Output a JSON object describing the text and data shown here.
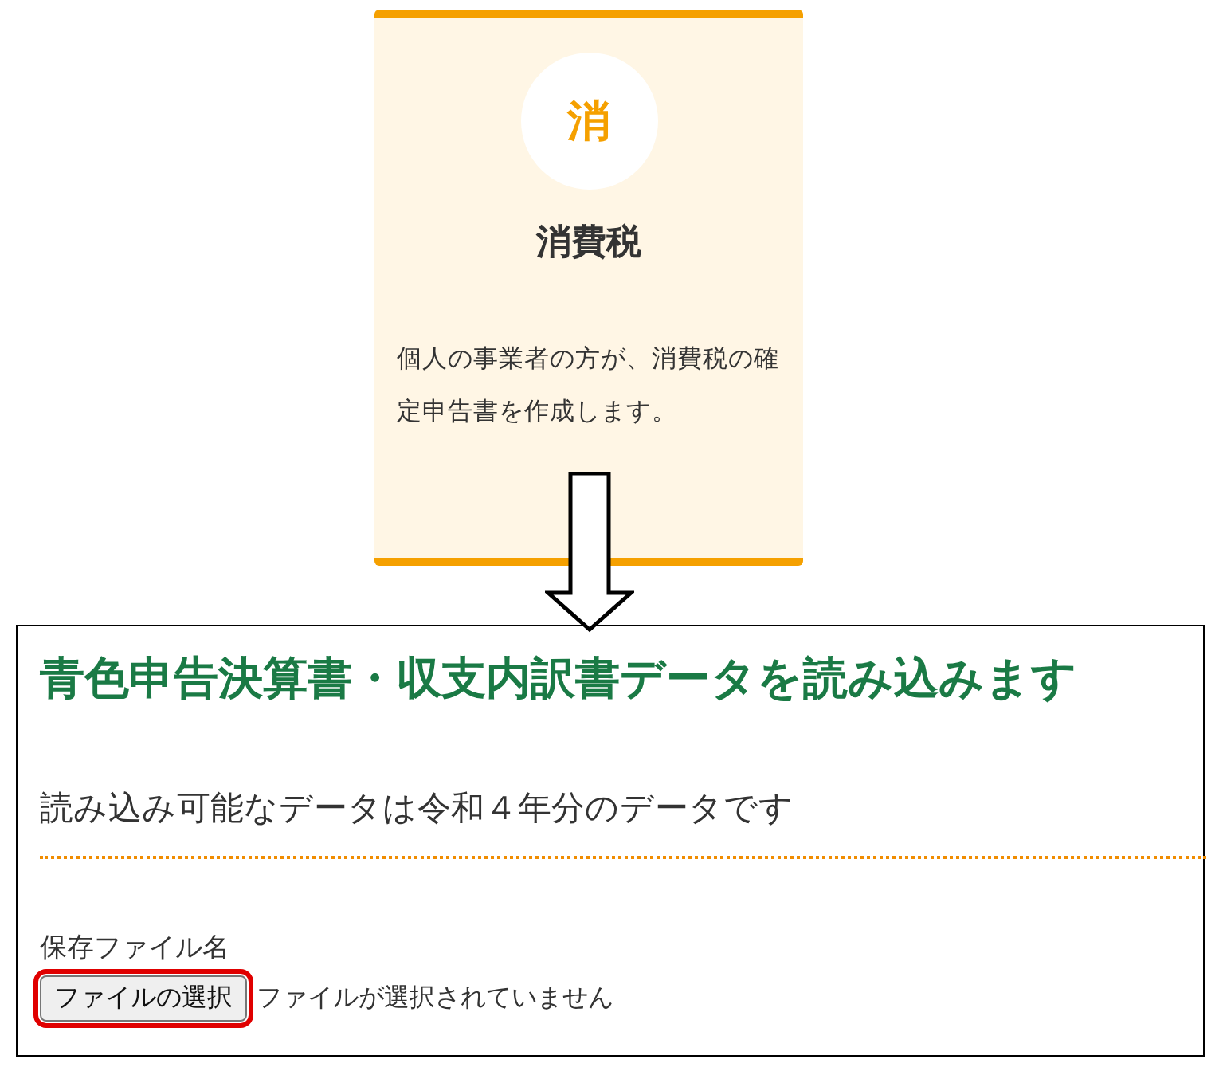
{
  "card": {
    "badge": "消",
    "title": "消費税",
    "description": "個人の事業者の方が、消費税の確定申告書を作成します。"
  },
  "panel": {
    "title": "青色申告決算書・収支内訳書データを読み込みます",
    "subtitle": "読み込み可能なデータは令和４年分のデータです",
    "file_label": "保存ファイル名",
    "file_button": {
      "label": "ファイルの選択",
      "highlighted": true
    },
    "file_status": "ファイルが選択されていません"
  }
}
